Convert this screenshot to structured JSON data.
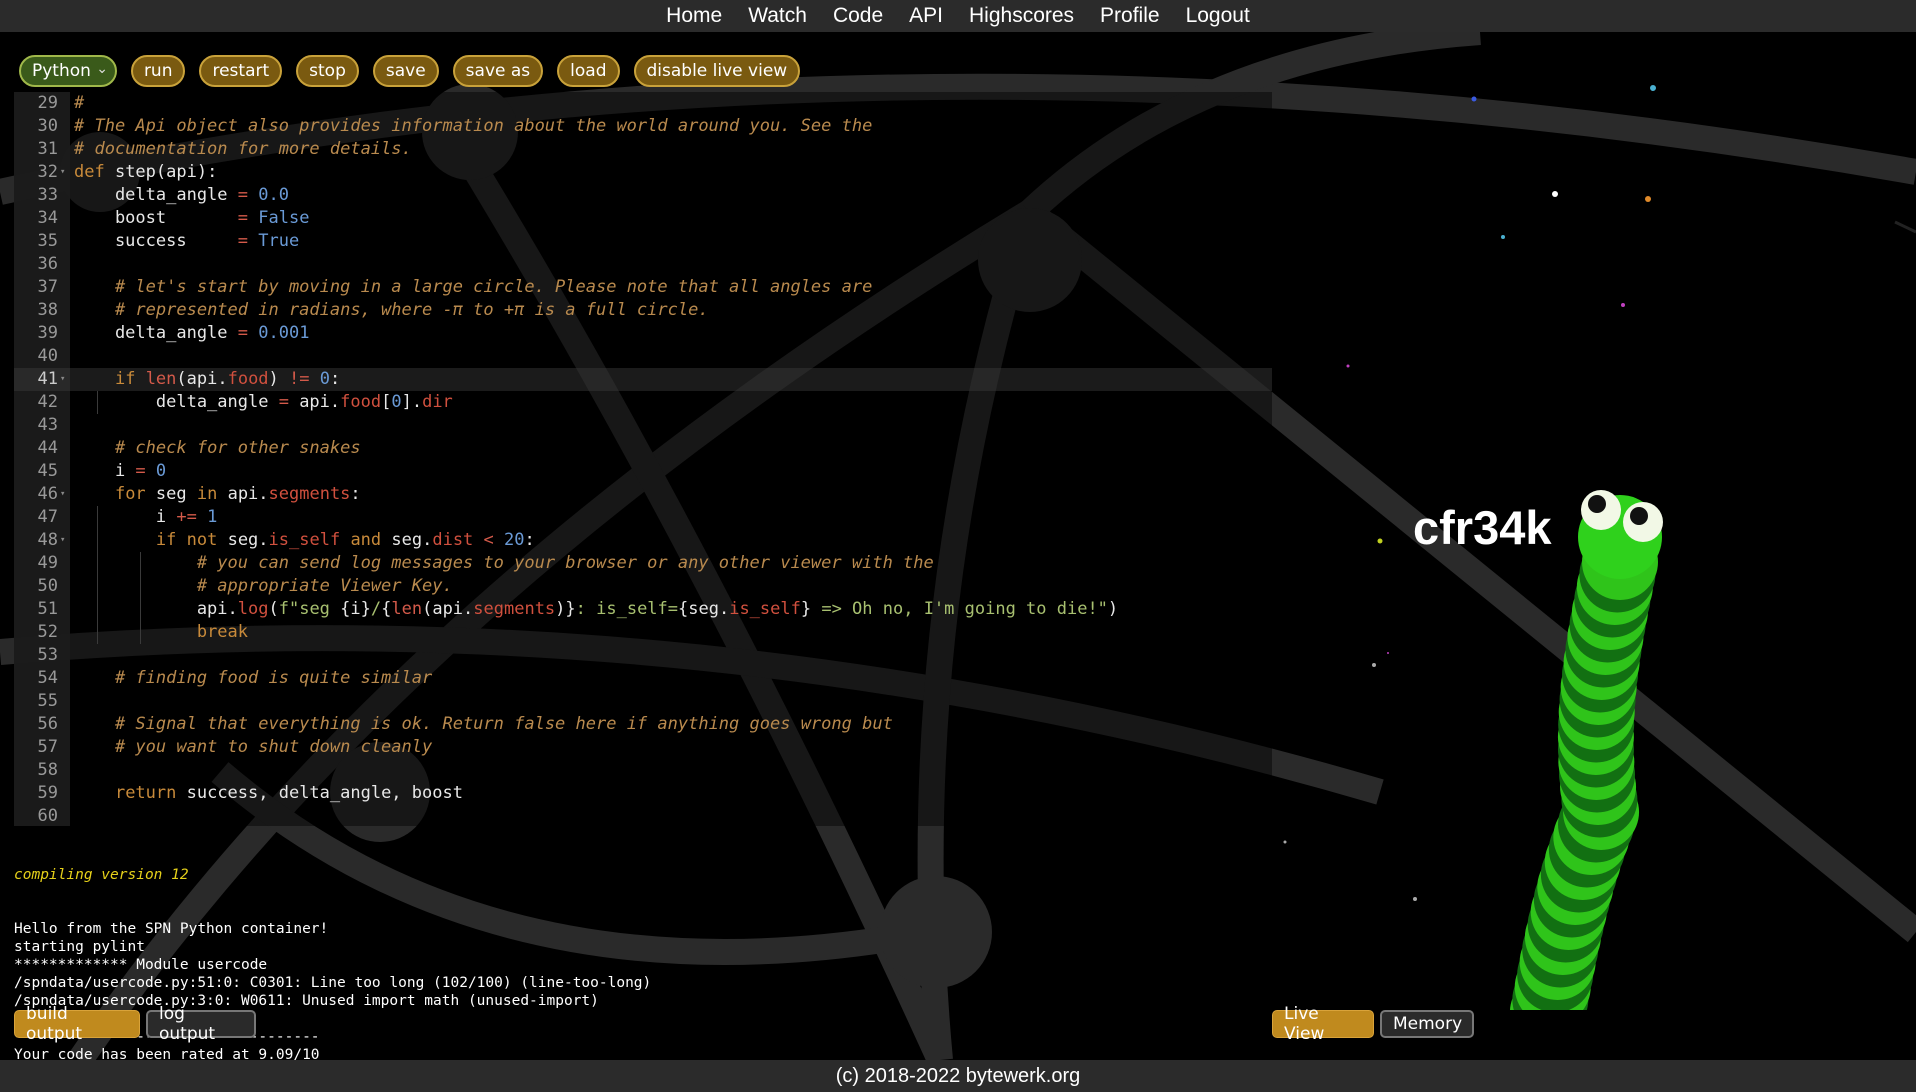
{
  "nav": {
    "items": [
      "Home",
      "Watch",
      "Code",
      "API",
      "Highscores",
      "Profile",
      "Logout"
    ]
  },
  "toolbar": {
    "language": "Python",
    "buttons": [
      "run",
      "restart",
      "stop",
      "save",
      "save as",
      "load",
      "disable live view"
    ]
  },
  "editor": {
    "active_line": 41,
    "lines": [
      {
        "n": "29",
        "segs": [
          [
            "cm",
            "#"
          ]
        ]
      },
      {
        "n": "30",
        "segs": [
          [
            "cm",
            "# The Api object also provides information about the world around you. See the"
          ]
        ]
      },
      {
        "n": "31",
        "segs": [
          [
            "cm",
            "# documentation for more details."
          ]
        ]
      },
      {
        "n": "32",
        "fold": true,
        "segs": [
          [
            "kw",
            "def"
          ],
          [
            "tx",
            " step(api):"
          ]
        ]
      },
      {
        "n": "33",
        "segs": [
          [
            "tx",
            "    delta_angle "
          ],
          [
            "op",
            "="
          ],
          [
            "tx",
            " "
          ],
          [
            "num",
            "0.0"
          ]
        ]
      },
      {
        "n": "34",
        "segs": [
          [
            "tx",
            "    boost       "
          ],
          [
            "op",
            "="
          ],
          [
            "tx",
            " "
          ],
          [
            "const",
            "False"
          ]
        ]
      },
      {
        "n": "35",
        "segs": [
          [
            "tx",
            "    success     "
          ],
          [
            "op",
            "="
          ],
          [
            "tx",
            " "
          ],
          [
            "const",
            "True"
          ]
        ]
      },
      {
        "n": "36",
        "segs": []
      },
      {
        "n": "37",
        "segs": [
          [
            "tx",
            "    "
          ],
          [
            "cm",
            "# let's start by moving in a large circle. Please note that all angles are"
          ]
        ]
      },
      {
        "n": "38",
        "segs": [
          [
            "tx",
            "    "
          ],
          [
            "cm",
            "# represented in radians, where -π to +π is a full circle."
          ]
        ]
      },
      {
        "n": "39",
        "segs": [
          [
            "tx",
            "    delta_angle "
          ],
          [
            "op",
            "="
          ],
          [
            "tx",
            " "
          ],
          [
            "num",
            "0.001"
          ]
        ]
      },
      {
        "n": "40",
        "segs": []
      },
      {
        "n": "41",
        "fold": true,
        "segs": [
          [
            "tx",
            "    "
          ],
          [
            "kw",
            "if"
          ],
          [
            "tx",
            " "
          ],
          [
            "fn",
            "len"
          ],
          [
            "tx",
            "(api."
          ],
          [
            "prop",
            "food"
          ],
          [
            "tx",
            ") "
          ],
          [
            "op",
            "!="
          ],
          [
            "tx",
            " "
          ],
          [
            "num",
            "0"
          ],
          [
            "tx",
            ":"
          ]
        ]
      },
      {
        "n": "42",
        "segs": [
          [
            "tx",
            "        delta_angle "
          ],
          [
            "op",
            "="
          ],
          [
            "tx",
            " api."
          ],
          [
            "prop",
            "food"
          ],
          [
            "tx",
            "["
          ],
          [
            "num",
            "0"
          ],
          [
            "tx",
            "]."
          ],
          [
            "prop",
            "dir"
          ]
        ]
      },
      {
        "n": "43",
        "segs": []
      },
      {
        "n": "44",
        "segs": [
          [
            "tx",
            "    "
          ],
          [
            "cm",
            "# check for other snakes"
          ]
        ]
      },
      {
        "n": "45",
        "segs": [
          [
            "tx",
            "    i "
          ],
          [
            "op",
            "="
          ],
          [
            "tx",
            " "
          ],
          [
            "num",
            "0"
          ]
        ]
      },
      {
        "n": "46",
        "fold": true,
        "segs": [
          [
            "tx",
            "    "
          ],
          [
            "kw",
            "for"
          ],
          [
            "tx",
            " seg "
          ],
          [
            "kw",
            "in"
          ],
          [
            "tx",
            " api."
          ],
          [
            "prop",
            "segments"
          ],
          [
            "tx",
            ":"
          ]
        ]
      },
      {
        "n": "47",
        "segs": [
          [
            "tx",
            "        i "
          ],
          [
            "op",
            "+="
          ],
          [
            "tx",
            " "
          ],
          [
            "num",
            "1"
          ]
        ]
      },
      {
        "n": "48",
        "fold": true,
        "segs": [
          [
            "tx",
            "        "
          ],
          [
            "kw",
            "if"
          ],
          [
            "tx",
            " "
          ],
          [
            "kw",
            "not"
          ],
          [
            "tx",
            " seg."
          ],
          [
            "prop",
            "is_self"
          ],
          [
            "tx",
            " "
          ],
          [
            "kw",
            "and"
          ],
          [
            "tx",
            " seg."
          ],
          [
            "prop",
            "dist"
          ],
          [
            "tx",
            " "
          ],
          [
            "op",
            "<"
          ],
          [
            "tx",
            " "
          ],
          [
            "num",
            "20"
          ],
          [
            "tx",
            ":"
          ]
        ]
      },
      {
        "n": "49",
        "segs": [
          [
            "tx",
            "            "
          ],
          [
            "cm",
            "# you can send log messages to your browser or any other viewer with the"
          ]
        ]
      },
      {
        "n": "50",
        "segs": [
          [
            "tx",
            "            "
          ],
          [
            "cm",
            "# appropriate Viewer Key."
          ]
        ]
      },
      {
        "n": "51",
        "segs": [
          [
            "tx",
            "            api."
          ],
          [
            "prop",
            "log"
          ],
          [
            "tx",
            "("
          ],
          [
            "str",
            "f\"seg "
          ],
          [
            "tx",
            "{i}"
          ],
          [
            "str",
            "/"
          ],
          [
            "tx",
            "{"
          ],
          [
            "fn",
            "len"
          ],
          [
            "tx",
            "(api."
          ],
          [
            "prop",
            "segments"
          ],
          [
            "tx",
            ")}"
          ],
          [
            "str",
            ": is_self="
          ],
          [
            "tx",
            "{seg."
          ],
          [
            "prop",
            "is_self"
          ],
          [
            "tx",
            "}"
          ],
          [
            "str",
            " => Oh no, I'm going to die!\""
          ],
          [
            "tx",
            ")"
          ]
        ]
      },
      {
        "n": "52",
        "segs": [
          [
            "tx",
            "            "
          ],
          [
            "kw",
            "break"
          ]
        ]
      },
      {
        "n": "53",
        "segs": []
      },
      {
        "n": "54",
        "segs": [
          [
            "tx",
            "    "
          ],
          [
            "cm",
            "# finding food is quite similar"
          ]
        ]
      },
      {
        "n": "55",
        "segs": []
      },
      {
        "n": "56",
        "segs": [
          [
            "tx",
            "    "
          ],
          [
            "cm",
            "# Signal that everything is ok. Return false here if anything goes wrong but"
          ]
        ]
      },
      {
        "n": "57",
        "segs": [
          [
            "tx",
            "    "
          ],
          [
            "cm",
            "# you want to shut down cleanly"
          ]
        ]
      },
      {
        "n": "58",
        "segs": []
      },
      {
        "n": "59",
        "segs": [
          [
            "tx",
            "    "
          ],
          [
            "kw",
            "return"
          ],
          [
            "tx",
            " success, delta_angle, boost"
          ]
        ]
      },
      {
        "n": "60",
        "segs": []
      }
    ]
  },
  "console": {
    "compiling": "compiling version 12",
    "lines": [
      "Hello from the SPN Python container!",
      "starting pylint",
      "************* Module usercode",
      "/spndata/usercode.py:51:0: C0301: Line too long (102/100) (line-too-long)",
      "/spndata/usercode.py:3:0: W0611: Unused import math (unused-import)",
      "",
      "-----------------------------------",
      "Your code has been rated at 9.09/10"
    ]
  },
  "bottom_tabs": {
    "build_output": "build output",
    "log_output": "log output",
    "live_view": "Live View",
    "memory": "Memory"
  },
  "live": {
    "player_name": "cfr34k"
  },
  "footer": {
    "text": "(c) 2018-2022 bytewerk.org"
  },
  "colors": {
    "accent": "#c08a1e",
    "snake_green": "#2fc41a",
    "snake_dark": "#127012"
  }
}
